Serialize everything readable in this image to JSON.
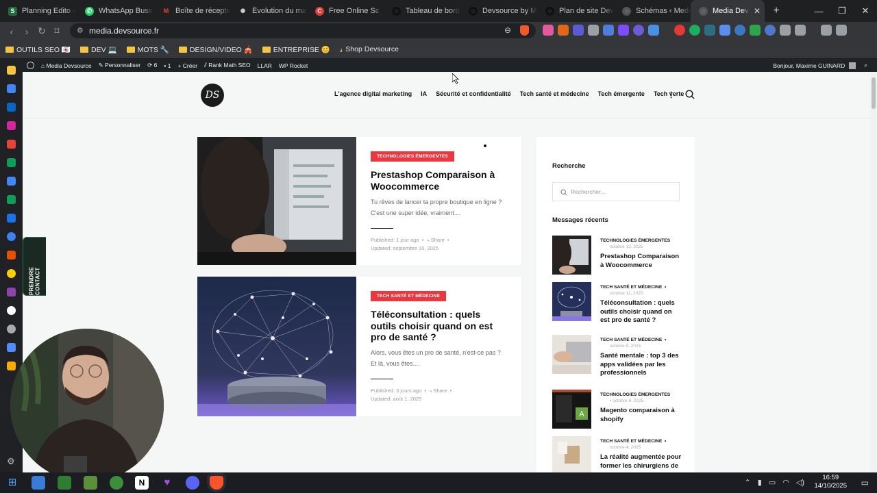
{
  "tabs": [
    {
      "label": "Planning Edito - Di",
      "color": "#1f6b3a",
      "glyph": "S"
    },
    {
      "label": "WhatsApp Business",
      "color": "#25d366",
      "glyph": "✆"
    },
    {
      "label": "Boîte de réception",
      "color": "#ea4335",
      "glyph": "M"
    },
    {
      "label": "Évolution du marché",
      "color": "#9aa0a6",
      "glyph": "✺"
    },
    {
      "label": "Free Online Sc",
      "color": "#e53935",
      "glyph": "C"
    },
    {
      "label": "Tableau de bord <",
      "color": "#202124",
      "glyph": "◌"
    },
    {
      "label": "Devsource by Max",
      "color": "#202124",
      "glyph": "◌"
    },
    {
      "label": "Plan de site Devso",
      "color": "#202124",
      "glyph": "◌"
    },
    {
      "label": "Schémas ‹ Media D",
      "color": "#9aa0a6",
      "glyph": "◌"
    },
    {
      "label": "Media Devsou",
      "color": "#9aa0a6",
      "glyph": "◌",
      "active": true
    }
  ],
  "browser": {
    "url": "media.devsource.fr"
  },
  "bookmarks": [
    "OUTILS SEO 🇾🇹",
    "DEV 💻",
    "MOTS 🔧",
    "DESIGN/VIDEO 🎪",
    "ENTREPRISE 😊",
    "Shop Devsource"
  ],
  "wp_admin": {
    "site": "Media Devsource",
    "customize": "Personnaliser",
    "updates": "6",
    "comments": "1",
    "create": "Créer",
    "rank_math": "Rank Math SEO",
    "llar": "LLAR",
    "rocket": "WP Rocket",
    "greeting": "Bonjour, Maxime GUINARD"
  },
  "contact_tab": "PRENDRE CONTACT",
  "site": {
    "logo": "DS",
    "menu": [
      "L'agence digital marketing",
      "IA",
      "Sécurité et confidentialité",
      "Tech santé et médecine",
      "Tech émergente",
      "Tech verte"
    ]
  },
  "posts": [
    {
      "category": "Technologies émergentes",
      "title": "Prestashop Comparaison à Woocommerce",
      "excerpt": "Tu rêves de lancer ta propre boutique en ligne ? C'est une super idée, vraiment....",
      "published": "Published: 1 jour ago",
      "share": "Share",
      "updated": "Updated: septembre 10, 2025"
    },
    {
      "category": "Tech santé et médecine",
      "title": "Téléconsultation : quels outils choisir quand on est pro de santé ?",
      "excerpt": "Alors, vous êtes un pro de santé, n'est-ce pas ? Et là, vous êtes....",
      "published": "Published: 3 jours ago",
      "share": "Share",
      "updated": "Updated: août 1, 2025"
    }
  ],
  "sidebar_widget": {
    "search_title": "Recherche",
    "search_placeholder": "Rechercher...",
    "recent_title": "Messages récents",
    "recent": [
      {
        "category": "TECHNOLOGIES ÉMERGENTES",
        "date": "octobre 13, 2025",
        "title": "Prestashop Comparaison à Woocommerce"
      },
      {
        "category": "TECH SANTÉ ET MÉDECINE",
        "date": "octobre 11, 2025",
        "title": "Téléconsultation : quels outils choisir quand on est pro de santé ?"
      },
      {
        "category": "TECH SANTÉ ET MÉDECINE",
        "date": "octobre 8, 2025",
        "title": "Santé mentale : top 3 des apps validées par les professionnels"
      },
      {
        "category": "TECHNOLOGIES ÉMERGENTES",
        "date": "octobre 6, 2025",
        "title": "Magento comparaison à shopify"
      },
      {
        "category": "TECH SANTÉ ET MÉDECINE",
        "date": "octobre 4, 2025",
        "title": "La réalité augmentée pour former les chirurgiens de"
      }
    ]
  },
  "clock": {
    "time": "16:59",
    "date": "14/10/2025"
  }
}
